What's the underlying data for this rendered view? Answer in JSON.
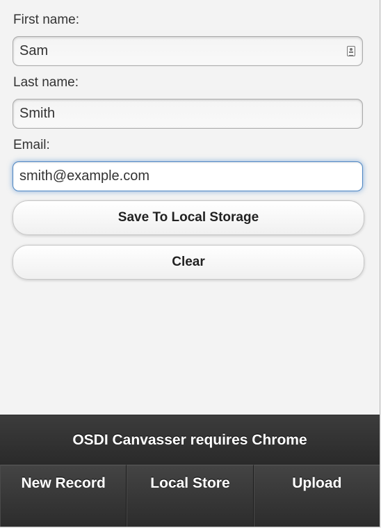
{
  "form": {
    "first_name": {
      "label": "First name:",
      "value": "Sam",
      "icon": "contact-card-icon"
    },
    "last_name": {
      "label": "Last name:",
      "value": "Smith"
    },
    "email": {
      "label": "Email:",
      "value": "smith@example.com",
      "focused": true
    }
  },
  "buttons": {
    "save": "Save To Local Storage",
    "clear": "Clear"
  },
  "footer": {
    "title": "OSDI Canvasser requires Chrome",
    "nav": [
      {
        "label": "New Record"
      },
      {
        "label": "Local Store"
      },
      {
        "label": "Upload"
      }
    ]
  },
  "colors": {
    "focus_accent": "#4f87c3",
    "footer_bg": "#2f2f2f"
  }
}
